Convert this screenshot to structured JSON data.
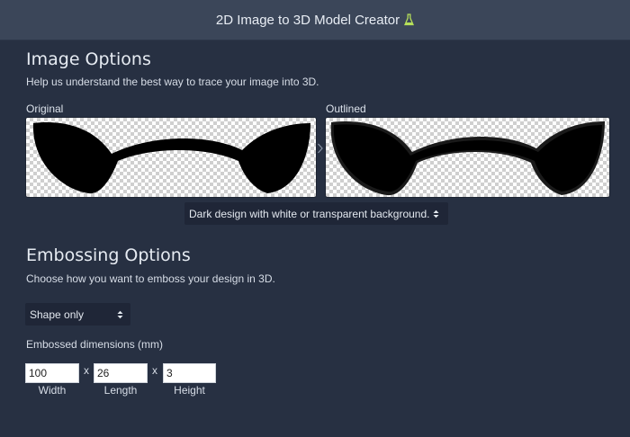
{
  "header": {
    "title": "2D Image to 3D Model Creator"
  },
  "image_options": {
    "title": "Image Options",
    "subtitle": "Help us understand the best way to trace your image into 3D.",
    "original_label": "Original",
    "outlined_label": "Outlined",
    "trace_mode": "Dark design with white or transparent background."
  },
  "embossing_options": {
    "title": "Embossing Options",
    "subtitle": "Choose how you want to emboss your design in 3D.",
    "emboss_mode": "Shape only",
    "dimensions_label": "Embossed dimensions (mm)",
    "width_value": "100",
    "length_value": "26",
    "height_value": "3",
    "separator": "x",
    "width_caption": "Width",
    "length_caption": "Length",
    "height_caption": "Height"
  },
  "icons": {
    "header": "flask-icon",
    "arrow": "chevron-right-icon",
    "select_caret": "up-down-caret-icon"
  },
  "colors": {
    "background": "#273042",
    "header_background": "#3b4659",
    "select_background": "#1f2637",
    "flask": "#b6e05a"
  }
}
